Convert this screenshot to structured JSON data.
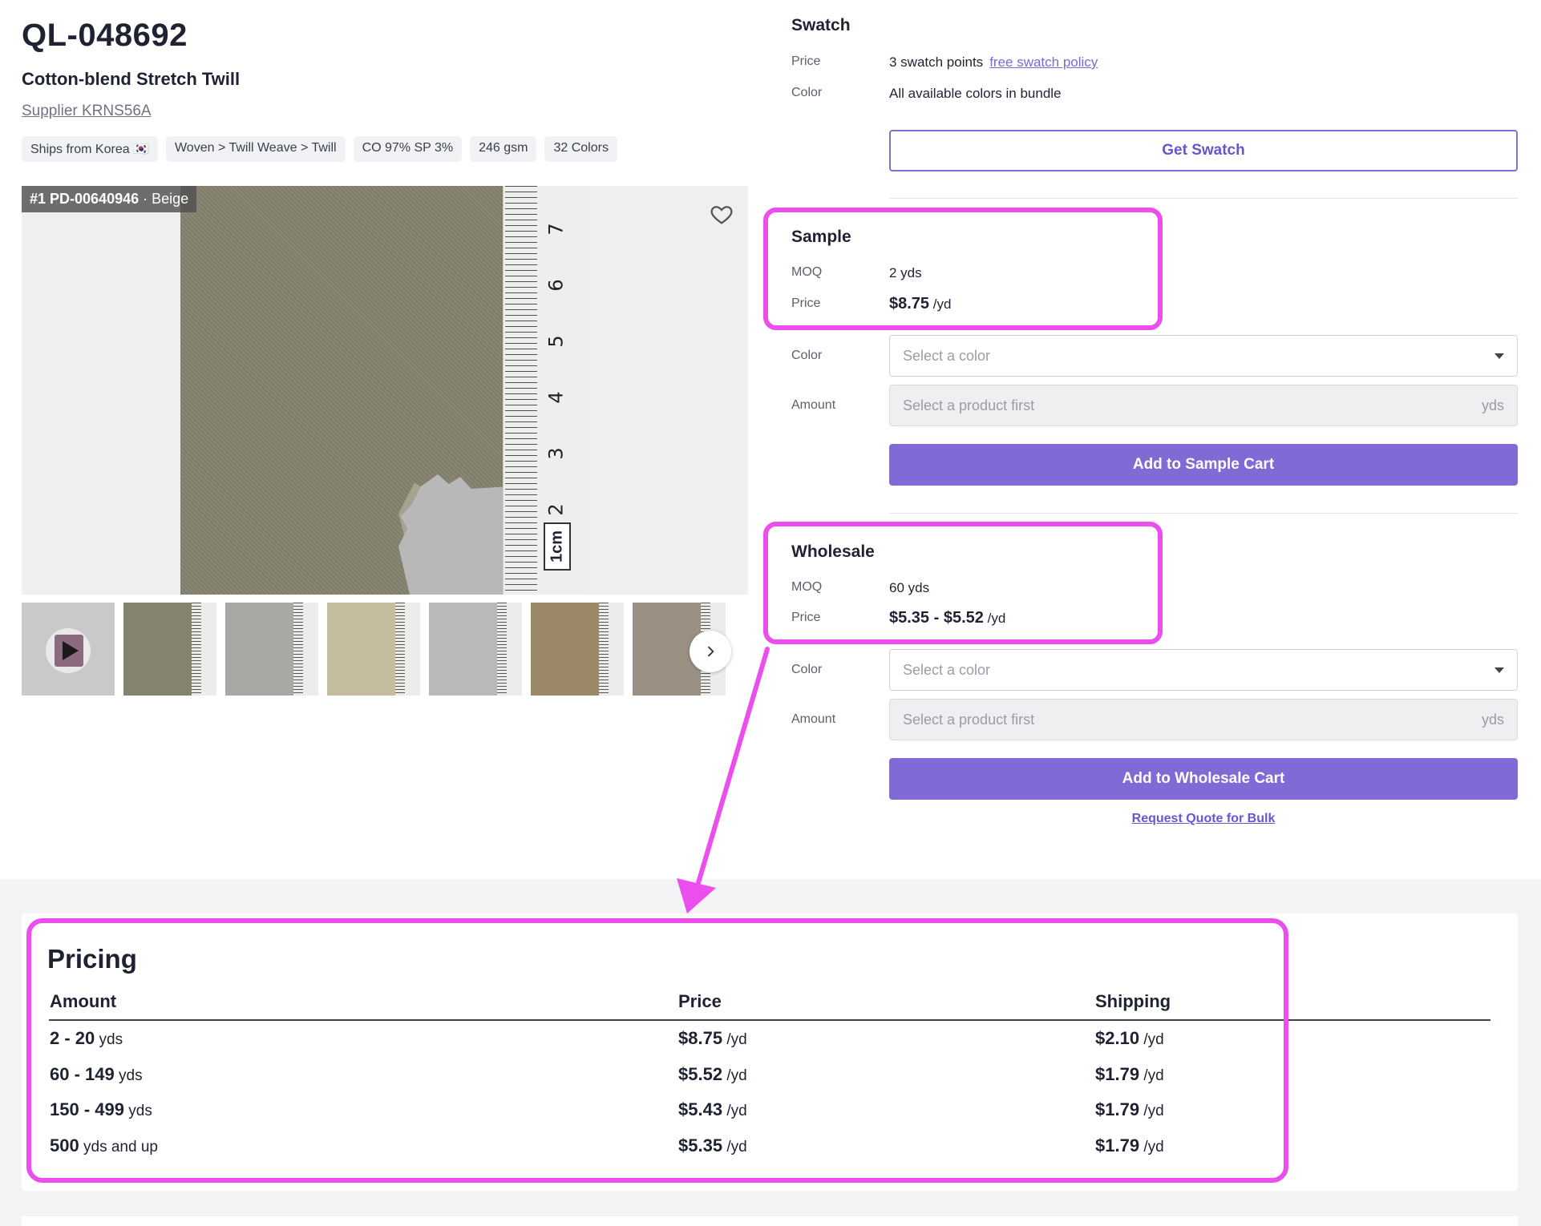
{
  "product": {
    "sku": "QL-048692",
    "name": "Cotton-blend Stretch Twill",
    "supplier": "Supplier KRNS56A",
    "tags": [
      "Ships from Korea 🇰🇷",
      "Woven > Twill Weave > Twill",
      "CO 97% SP 3%",
      "246 gsm",
      "32 Colors"
    ]
  },
  "gallery": {
    "label_id": "#1 PD-00640946",
    "label_color": "· Beige",
    "ruler_numbers": [
      "7",
      "6",
      "5",
      "4",
      "3",
      "2"
    ],
    "ruler_unit": "1cm",
    "thumbnail_colors": [
      "#85826f",
      "#a9a8a3",
      "#c5bd9c",
      "#b9b9b7",
      "#9a8868",
      "#9a9183"
    ]
  },
  "swatch": {
    "title": "Swatch",
    "price_label": "Price",
    "price_value": "3 swatch points",
    "policy_link": "free swatch policy",
    "color_label": "Color",
    "color_value": "All available colors in bundle",
    "button": "Get Swatch"
  },
  "sample": {
    "title": "Sample",
    "moq_label": "MOQ",
    "moq_value": "2 yds",
    "price_label": "Price",
    "price_value": "$8.75",
    "price_unit": "/yd",
    "color_label": "Color",
    "color_placeholder": "Select a color",
    "amount_label": "Amount",
    "amount_placeholder": "Select a product first",
    "amount_unit": "yds",
    "button": "Add to Sample Cart"
  },
  "wholesale": {
    "title": "Wholesale",
    "moq_label": "MOQ",
    "moq_value": "60 yds",
    "price_label": "Price",
    "price_value": "$5.35 - $5.52",
    "price_unit": "/yd",
    "color_label": "Color",
    "color_placeholder": "Select a color",
    "amount_label": "Amount",
    "amount_placeholder": "Select a product first",
    "amount_unit": "yds",
    "button": "Add to Wholesale Cart",
    "quote_link": "Request Quote for Bulk"
  },
  "pricing": {
    "title": "Pricing",
    "headers": [
      "Amount",
      "Price",
      "Shipping"
    ],
    "rows": [
      {
        "amount": "2 - 20",
        "amount_suffix": "yds",
        "price": "$8.75",
        "price_unit": "/yd",
        "shipping": "$2.10",
        "shipping_unit": "/yd"
      },
      {
        "amount": "60 - 149",
        "amount_suffix": "yds",
        "price": "$5.52",
        "price_unit": "/yd",
        "shipping": "$1.79",
        "shipping_unit": "/yd"
      },
      {
        "amount": "150 - 499",
        "amount_suffix": "yds",
        "price": "$5.43",
        "price_unit": "/yd",
        "shipping": "$1.79",
        "shipping_unit": "/yd"
      },
      {
        "amount": "500",
        "amount_suffix": "yds and up",
        "price": "$5.35",
        "price_unit": "/yd",
        "shipping": "$1.79",
        "shipping_unit": "/yd"
      }
    ]
  },
  "colors": {
    "accent": "#8169d6",
    "highlight": "#ec4ded"
  }
}
